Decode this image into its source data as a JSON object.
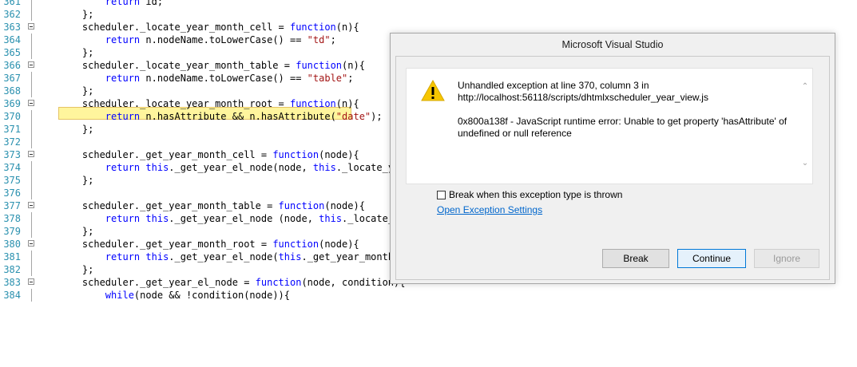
{
  "editor": {
    "lines": [
      {
        "num": "361",
        "text": "        return id;"
      },
      {
        "num": "362",
        "text": "    };"
      },
      {
        "num": "363",
        "text": "    scheduler._locate_year_month_cell = function(n){",
        "fold": true
      },
      {
        "num": "364",
        "text": "        return n.nodeName.toLowerCase() == \"td\";"
      },
      {
        "num": "365",
        "text": "    };"
      },
      {
        "num": "366",
        "text": "    scheduler._locate_year_month_table = function(n){",
        "fold": true
      },
      {
        "num": "367",
        "text": "        return n.nodeName.toLowerCase() == \"table\";"
      },
      {
        "num": "368",
        "text": "    };"
      },
      {
        "num": "369",
        "text": "    scheduler._locate_year_month_root = function(n){",
        "fold": true
      },
      {
        "num": "370",
        "text": "        return n.hasAttribute && n.hasAttribute(\"date\");",
        "current": true
      },
      {
        "num": "371",
        "text": "    };"
      },
      {
        "num": "372",
        "text": ""
      },
      {
        "num": "373",
        "text": "    scheduler._get_year_month_cell = function(node){",
        "fold": true
      },
      {
        "num": "374",
        "text": "        return this._get_year_el_node(node, this._locate_year_m"
      },
      {
        "num": "375",
        "text": "    };"
      },
      {
        "num": "376",
        "text": ""
      },
      {
        "num": "377",
        "text": "    scheduler._get_year_month_table = function(node){",
        "fold": true
      },
      {
        "num": "378",
        "text": "        return this._get_year_el_node (node, this._locate_year_"
      },
      {
        "num": "379",
        "text": "    };"
      },
      {
        "num": "380",
        "text": "    scheduler._get_year_month_root = function(node){",
        "fold": true
      },
      {
        "num": "381",
        "text": "        return this._get_year_el_node(this._get_year_month_tabl"
      },
      {
        "num": "382",
        "text": "    };"
      },
      {
        "num": "383",
        "text": "    scheduler._get_year_el_node = function(node, condition){",
        "fold": true
      },
      {
        "num": "384",
        "text": "        while(node && !condition(node)){"
      }
    ]
  },
  "dialog": {
    "title": "Microsoft Visual Studio",
    "icon": "warning-icon",
    "message_line1": "Unhandled exception at line 370, column 3 in",
    "message_line2": "http://localhost:56118/scripts/dhtmlxscheduler_year_view.js",
    "error_line1": "0x800a138f - JavaScript runtime error: Unable to get property 'hasAttribute' of",
    "error_line2": "undefined or null reference",
    "checkbox_label": "Break when this exception type is thrown",
    "checkbox_checked": false,
    "link_label": "Open Exception Settings",
    "buttons": {
      "break": "Break",
      "continue": "Continue",
      "ignore": "Ignore"
    }
  },
  "colors": {
    "line_number": "#2b91af",
    "keyword": "#0000ff",
    "string": "#a31515",
    "current_line_highlight": "#fff59d",
    "link": "#0066cc"
  }
}
